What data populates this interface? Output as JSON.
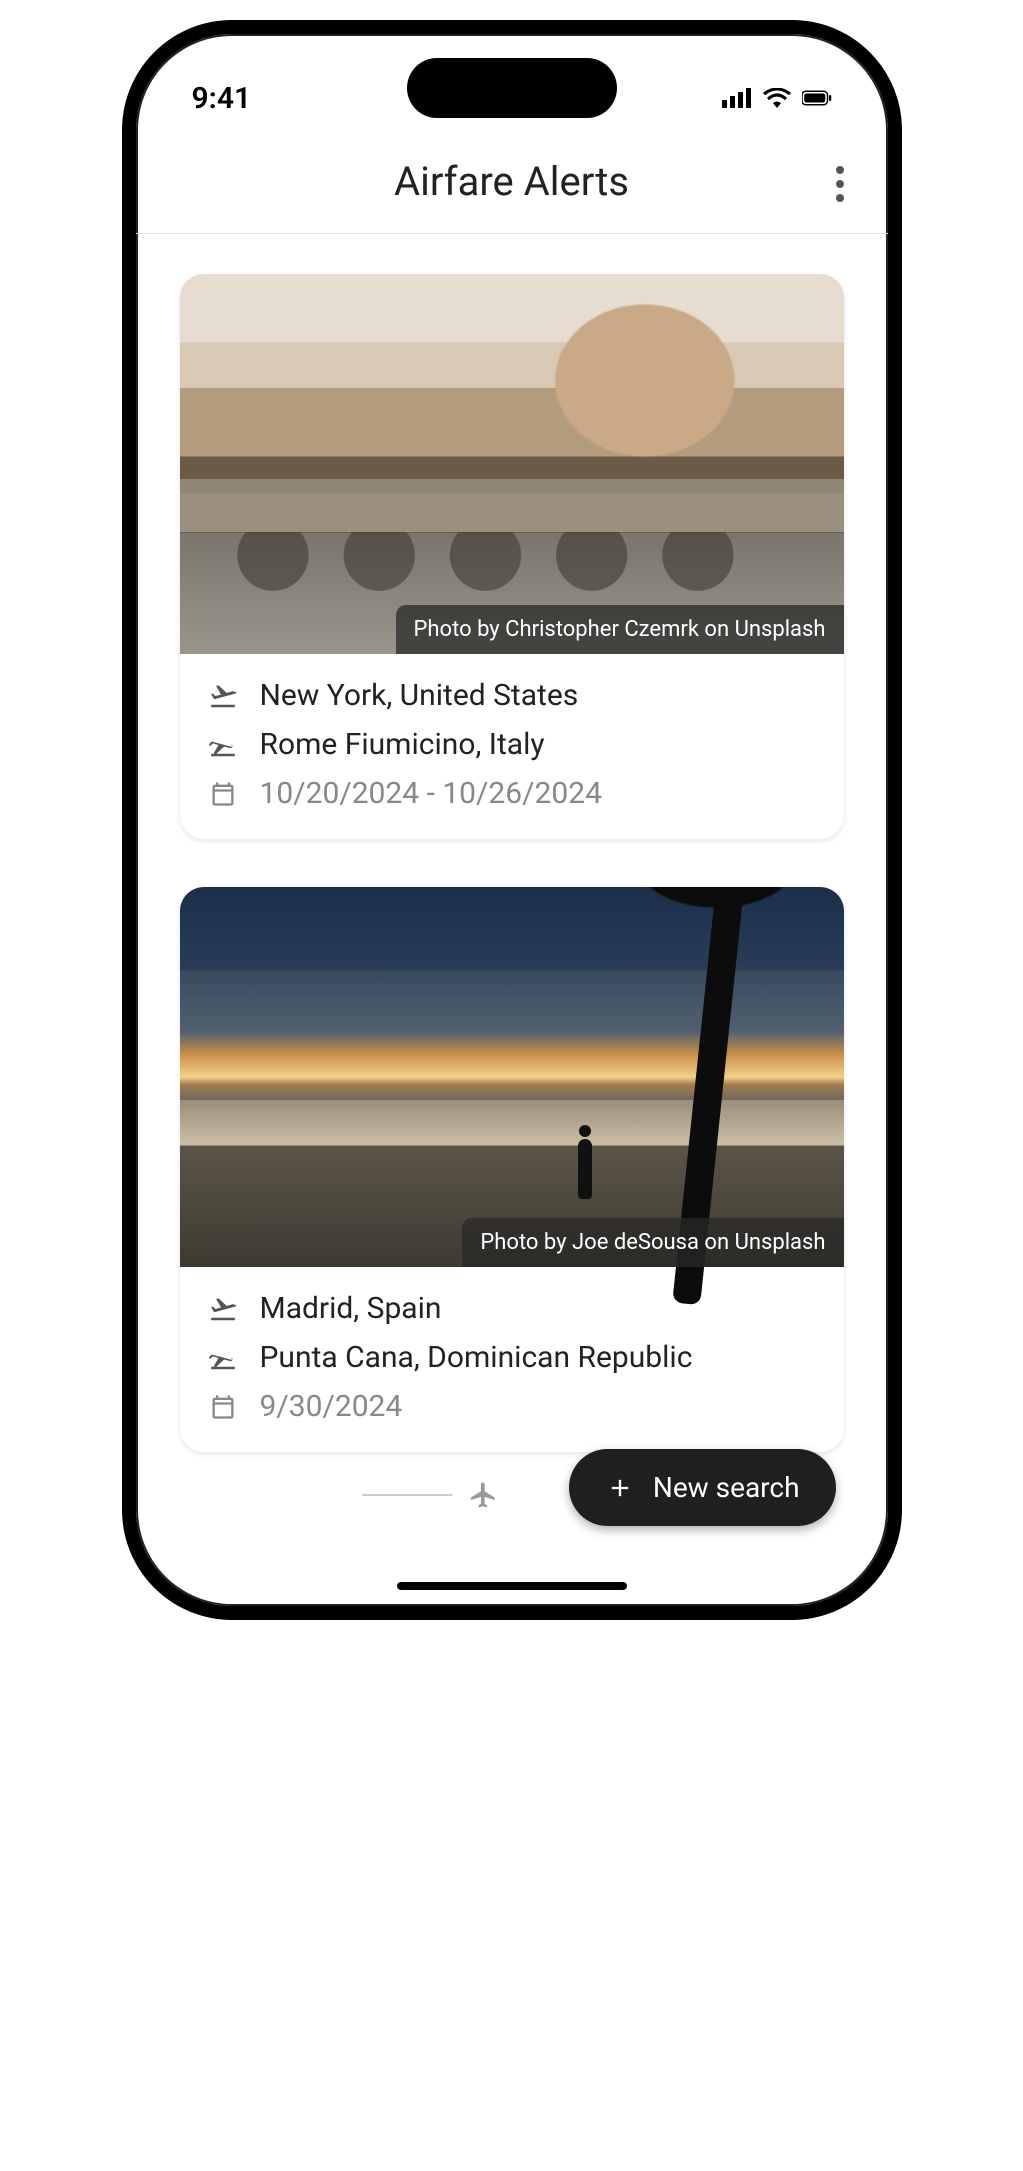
{
  "status": {
    "time": "9:41"
  },
  "header": {
    "title": "Airfare Alerts"
  },
  "cards": [
    {
      "credit": "Photo by Christopher Czemrk on Unsplash",
      "origin": "New York, United States",
      "destination": "Rome Fiumicino, Italy",
      "dates": "10/20/2024 - 10/26/2024"
    },
    {
      "credit": "Photo by Joe deSousa on Unsplash",
      "origin": "Madrid, Spain",
      "destination": "Punta Cana, Dominican Republic",
      "dates": "9/30/2024"
    }
  ],
  "fab": {
    "label": "New search"
  }
}
